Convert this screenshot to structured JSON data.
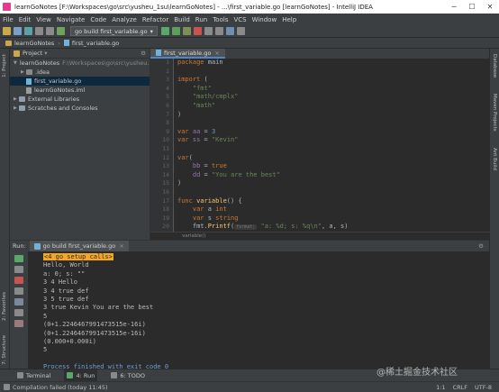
{
  "title_bar": {
    "text": "learnGoNotes [F:\\Workspaces\\go\\src\\yusheu_1su\\learnGoNotes] - ...\\first_variable.go [learnGoNotes] - IntelliJ IDEA"
  },
  "menu": [
    "File",
    "Edit",
    "View",
    "Navigate",
    "Code",
    "Analyze",
    "Refactor",
    "Build",
    "Run",
    "Tools",
    "VCS",
    "Window",
    "Help"
  ],
  "toolbar": {
    "run_config": "go build first_variable.go"
  },
  "breadcrumb_nav": [
    "learnGoNotes",
    "first_variable.go"
  ],
  "left_strip": [
    "1: Project",
    "2: Favorites",
    "7: Structure"
  ],
  "right_strip": [
    "Database",
    "Maven Projects",
    "Ant Build"
  ],
  "project": {
    "header": "Project",
    "tree": [
      {
        "label": "learnGoNotes",
        "path": "F:\\Workspaces\\go\\src\\yusheu..."
      },
      {
        "label": ".idea"
      },
      {
        "label": "first_variable.go"
      },
      {
        "label": "learnGoNotes.iml"
      },
      {
        "label": "External Libraries"
      },
      {
        "label": "Scratches and Consoles"
      }
    ]
  },
  "editor": {
    "tab": "first_variable.go",
    "footer_crumb": "variable()",
    "line_numbers": [
      "1",
      "2",
      "3",
      "4",
      "5",
      "6",
      "7",
      "8",
      "9",
      "10",
      "11",
      "12",
      "13",
      "14",
      "15",
      "16",
      "17",
      "18",
      "19",
      "20",
      "21"
    ],
    "code": {
      "l1a": "package",
      "l1b": " main",
      "l3a": "import",
      "l3b": " (",
      "l4": "    \"fmt\"",
      "l5": "    \"math/cmplx\"",
      "l6": "    \"math\"",
      "l7": ")",
      "l9a": "var",
      "l9b": " aa",
      "l9c": " = ",
      "l9d": "3",
      "l10a": "var",
      "l10b": " ss",
      "l10c": " = ",
      "l10d": "\"Kevin\"",
      "l12a": "var",
      "l12b": "(",
      "l13a": "    bb",
      "l13b": " = ",
      "l13c": "true",
      "l14a": "    dd",
      "l14b": " = ",
      "l14c": "\"You are the best\"",
      "l15": ")",
      "l17a": "func",
      "l17b": " variable",
      "l17c": "() {",
      "l18a": "    var",
      "l18b": " a ",
      "l18c": "int",
      "l19a": "    var",
      "l19b": " s ",
      "l19c": "string",
      "l20a": "    fmt.",
      "l20b": "Printf",
      "l20c": "(",
      "l20d": "format:",
      "l20e": " \"a: %d; s: %q\\n\"",
      "l20f": ", a, s)",
      "l21": "}"
    }
  },
  "run": {
    "label": "Run:",
    "tab": "go build first_variable.go",
    "output": [
      "<4 go setup calls>",
      "Hello, World",
      "a: 0; s: \"\"",
      "3 4 Hello",
      "3 4 true def",
      "3 5 true def",
      "3 true Kevin You are the best",
      "5",
      "(0+1.2246467991473515e-16i)",
      "(0+1.2246467991473515e-16i)",
      "(0.000+0.000i)",
      "5",
      "",
      "Process finished with exit code 0"
    ]
  },
  "bottom_tabs": [
    "Terminal",
    "4: Run",
    "6: TODO"
  ],
  "status": {
    "message": "Compilation failed (today 11:45)",
    "position": "1:1",
    "line_sep": "CRLF",
    "encoding": "UTF-8"
  },
  "watermark": "@稀土掘金技术社区",
  "colors": {
    "keyword": "#cc7832",
    "string": "#6a8759",
    "function": "#ffc66d",
    "number": "#6897bb",
    "run_green": "#59a869",
    "stop_red": "#c75450"
  }
}
